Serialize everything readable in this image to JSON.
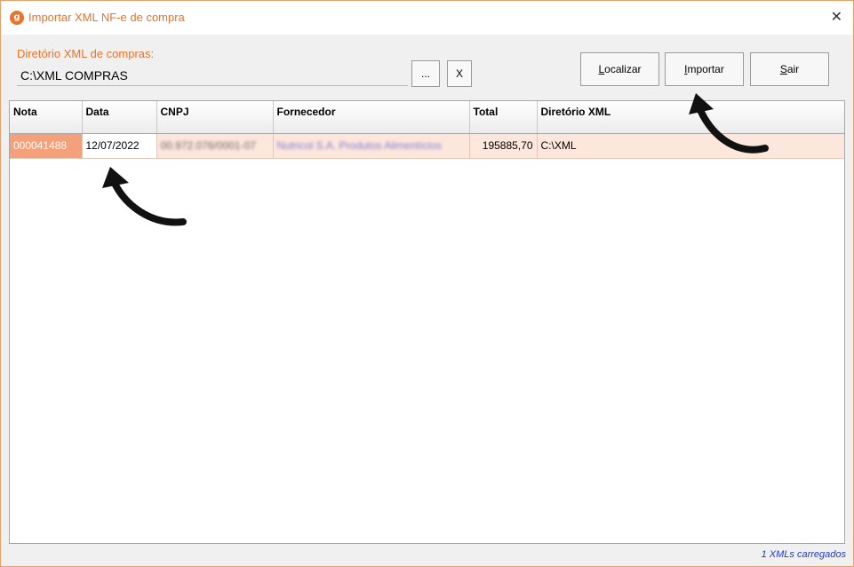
{
  "window": {
    "title": "Importar XML NF-e de compra",
    "app_icon": "app-logo-icon",
    "app_icon_letter": "g",
    "close_glyph": "✕"
  },
  "directory": {
    "label": "Diretório XML de compras:",
    "value": "C:\\XML COMPRAS",
    "browse_label": "...",
    "clear_label": "X"
  },
  "toolbar": {
    "localizar": {
      "accel": "L",
      "rest": "ocalizar"
    },
    "importar": {
      "accel": "I",
      "rest": "mportar"
    },
    "sair": {
      "accel": "S",
      "rest": "air"
    }
  },
  "grid": {
    "columns": [
      "Nota",
      "Data",
      "CNPJ",
      "Fornecedor",
      "Total",
      "Diretório XML"
    ],
    "rows": [
      {
        "nota": "000041488",
        "data": "12/07/2022",
        "cnpj": "00.972.076/0001-07",
        "fornecedor": "Nutricol S.A. Produtos Alimentícios",
        "total": "195885,70",
        "diretorio": "C:\\XML"
      }
    ]
  },
  "status": "1 XMLs carregados",
  "colors": {
    "accent": "#e8732a",
    "selected_cell": "#f4a07a",
    "row_highlight": "#fde6dc",
    "status_text": "#1e3cc8"
  },
  "annotations": [
    "curved-arrow-pointing-data-cell",
    "curved-arrow-pointing-importar-button"
  ]
}
